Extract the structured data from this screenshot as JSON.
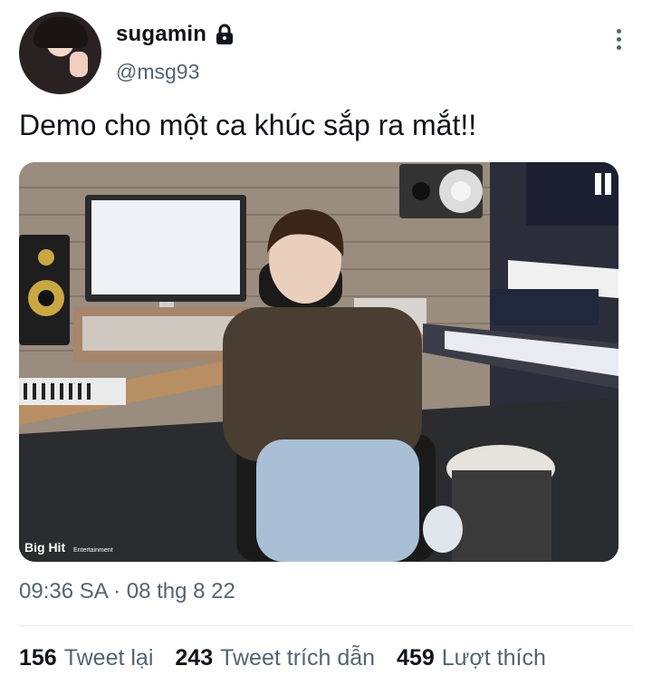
{
  "author": {
    "display_name": "sugamin",
    "handle": "@msg93",
    "avatar_icon": "profile-avatar",
    "protected_icon": "lock-icon"
  },
  "tweet": {
    "text": "Demo cho một ca khúc sắp ra mắt!!",
    "timestamp": "09:36 SA · 08 thg 8 22",
    "photo": {
      "watermark_brand": "Big Hit",
      "watermark_sub": "Entertainment"
    }
  },
  "stats": [
    {
      "count": "156",
      "label": "Tweet lại"
    },
    {
      "count": "243",
      "label": "Tweet trích dẫn"
    },
    {
      "count": "459",
      "label": "Lượt thích"
    }
  ],
  "colors": {
    "text_primary": "#0f1419",
    "text_secondary": "#536471",
    "divider": "#e3e7ea"
  }
}
